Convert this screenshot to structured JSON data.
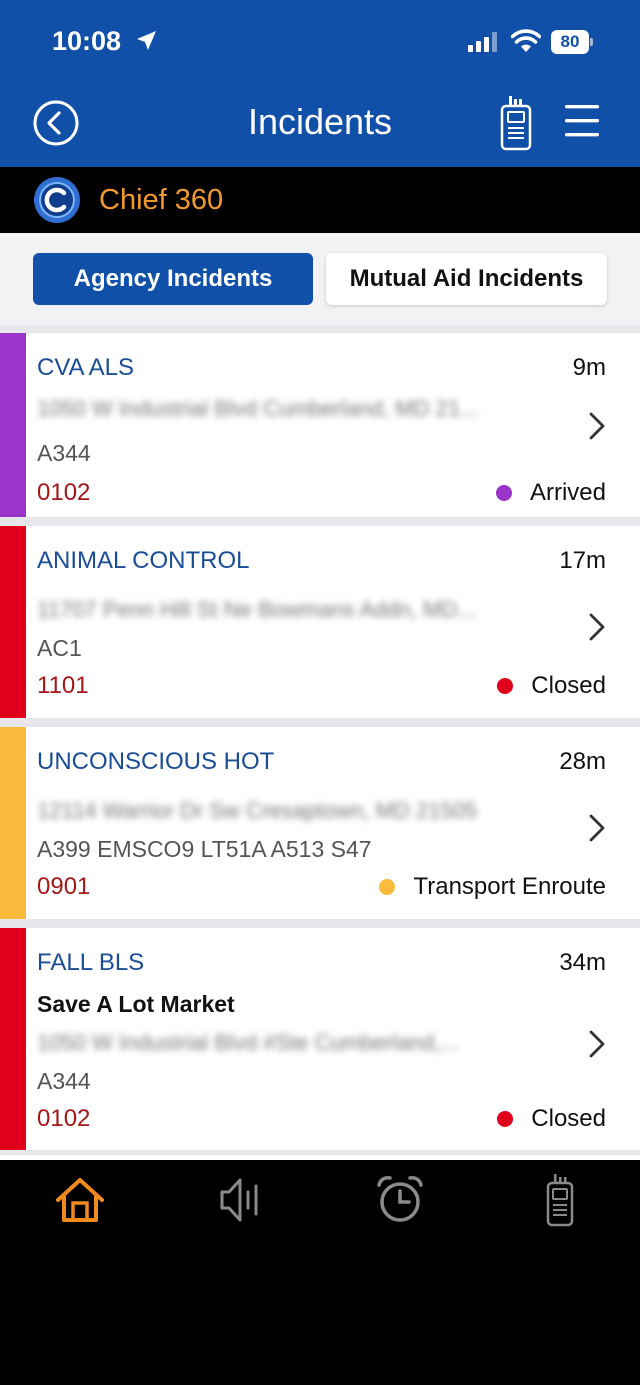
{
  "status_bar": {
    "time": "10:08",
    "battery": "80"
  },
  "header": {
    "title": "Incidents"
  },
  "brand": {
    "name": "Chief 360"
  },
  "tabs": [
    {
      "label": "Agency Incidents",
      "active": true
    },
    {
      "label": "Mutual Aid Incidents",
      "active": false
    }
  ],
  "incidents": [
    {
      "type": "CVA ALS",
      "age": "9m",
      "address": "1050 W Industrial Blvd Cumberland, MD 21...",
      "place": "",
      "units": "A344",
      "number": "0102",
      "status": "Arrived",
      "stripe_color": "#9b35c9",
      "status_color": "#9b35c9"
    },
    {
      "type": "ANIMAL CONTROL",
      "age": "17m",
      "address": "11707 Penn Hill St Ne Bowmans Addn, MD...",
      "place": "",
      "units": "AC1",
      "number": "1101",
      "status": "Closed",
      "stripe_color": "#e0001b",
      "status_color": "#e0001b"
    },
    {
      "type": "UNCONSCIOUS HOT",
      "age": "28m",
      "address": "12114 Warrior Dr Sw Cresaptown, MD 21505",
      "place": "",
      "units": "A399 EMSCO9 LT51A A513 S47",
      "number": "0901",
      "status": "Transport Enroute",
      "stripe_color": "#f8bb3c",
      "status_color": "#f8bb3c"
    },
    {
      "type": "FALL BLS",
      "age": "34m",
      "address": "1050 W Industrial Blvd #Ste Cumberland,...",
      "place": "Save A Lot Market",
      "units": "A344",
      "number": "0102",
      "status": "Closed",
      "stripe_color": "#e0001b",
      "status_color": "#e0001b"
    }
  ],
  "bottom_nav": [
    {
      "icon": "home-icon",
      "active": true,
      "color": "#f08a1c"
    },
    {
      "icon": "speaker-icon",
      "active": false,
      "color": "#8a8a8a"
    },
    {
      "icon": "alarm-clock-icon",
      "active": false,
      "color": "#8a8a8a"
    },
    {
      "icon": "radio-icon",
      "active": false,
      "color": "#8a8a8a"
    }
  ],
  "colors": {
    "header_blue": "#1150a8",
    "brand_orange": "#f39a2e",
    "type_blue": "#1a4d96",
    "number_red": "#a21818"
  }
}
